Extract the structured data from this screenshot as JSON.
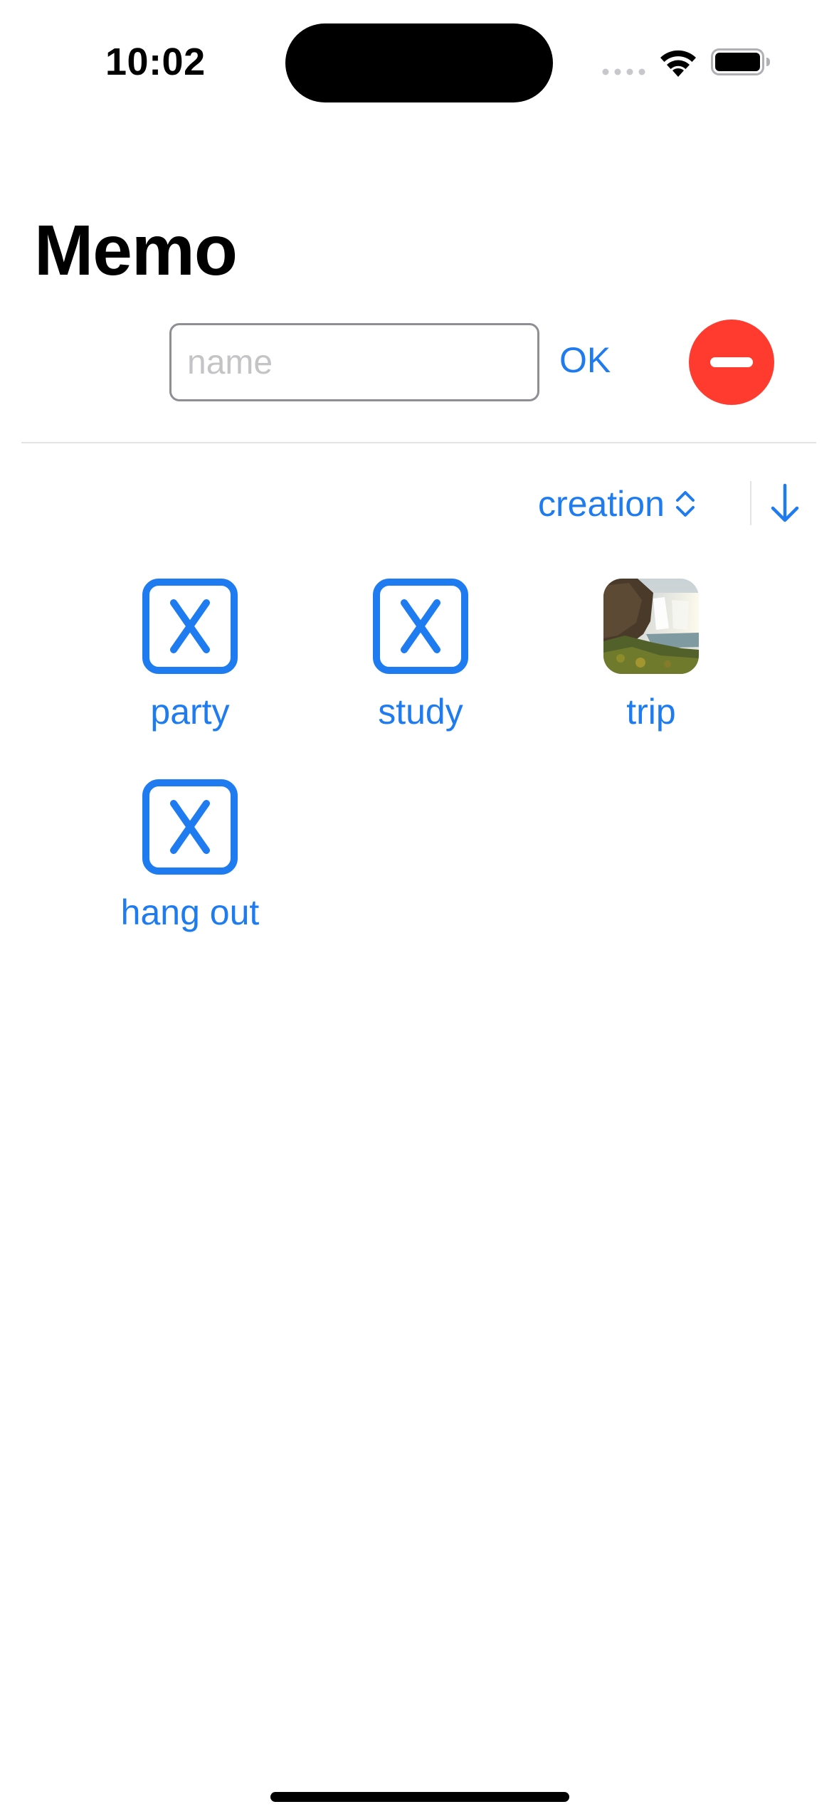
{
  "status_bar": {
    "time": "10:02"
  },
  "title": "Memo",
  "input": {
    "value": "",
    "placeholder": "name"
  },
  "ok_label": "OK",
  "sort": {
    "label": "creation",
    "direction": "descending"
  },
  "items": [
    {
      "label": "party",
      "icon": "xmark-square-icon"
    },
    {
      "label": "study",
      "icon": "xmark-square-icon"
    },
    {
      "label": "trip",
      "icon": "waterfall-photo"
    },
    {
      "label": "hang out",
      "icon": "xmark-square-icon"
    }
  ],
  "colors": {
    "accent": "#1e7cf0",
    "delete": "#ff3b30",
    "background": "#ffffff"
  }
}
